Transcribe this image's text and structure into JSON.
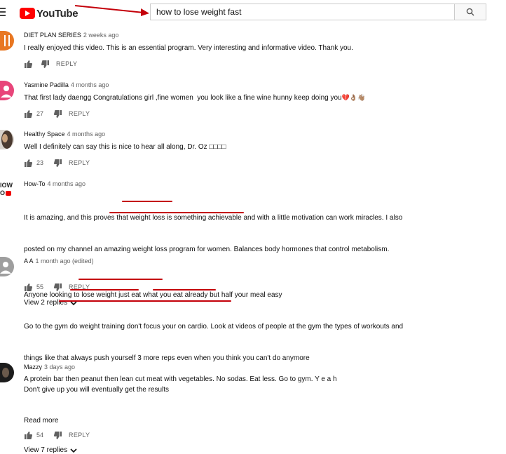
{
  "header": {
    "logo_text": "YouTube",
    "search_value": "how to lose weight fast"
  },
  "colors": {
    "brand": "#ff0000",
    "annotation": "#c4000a"
  },
  "comments": [
    {
      "avatar": "orange-utensils-avatar",
      "author": "DIET PLAN SERIES",
      "time": "2 weeks ago",
      "text": "I really enjoyed this video. This is an essential program. Very interesting and informative video. Thank you.",
      "likes": "",
      "reply_label": "REPLY"
    },
    {
      "avatar": "pink-person-avatar",
      "author": "Yasmine Padilla",
      "time": "4 months ago",
      "text": "That first lady daengg Congratulations girl ,fine women  you look like a fine wine hunny keep doing you",
      "emoji_text": "💔👌🏽👋🏽",
      "likes": "27",
      "reply_label": "REPLY"
    },
    {
      "avatar": "dark-hair-avatar",
      "author": "Healthy Space",
      "time": "4 months ago",
      "text": "Well I definitely can say this is nice to hear all along, Dr. Oz □□□□",
      "likes": "23",
      "reply_label": "REPLY"
    },
    {
      "avatar_text_1": "IOW",
      "avatar_text_2": "O",
      "author": "How-To",
      "time": "4 months ago",
      "line1": "It is amazing, and this proves that weight loss is something achievable and with a little motivation can work miracles. I also",
      "line2": "posted on my channel an amazing weight loss program for women. Balances body hormones that control metabolism.",
      "likes": "55",
      "reply_label": "REPLY",
      "view_replies": "View 2 replies"
    },
    {
      "avatar": "gray-person-avatar",
      "author": "A A",
      "time": "1 month ago (edited)",
      "line1": "Anyone looking to lose weight just eat what you eat already but half your meal easy",
      "line2": "Go to the gym do weight training don't focus your on cardio. Look at videos of people at the gym the types of workouts and",
      "line3": "things like that always push yourself 3 more reps even when you think you can't do anymore",
      "line4": "Don't give up you will eventually get the results",
      "read_more": "Read more",
      "likes": "54",
      "reply_label": "REPLY",
      "view_replies": "View 7 replies"
    },
    {
      "avatar": "dark-photo-avatar",
      "author": "Mazzy",
      "time": "3 days ago",
      "text": "A protein bar then peanut then lean cut meat with vegetables. No sodas. Eat less. Go to gym. Y e a h"
    }
  ]
}
